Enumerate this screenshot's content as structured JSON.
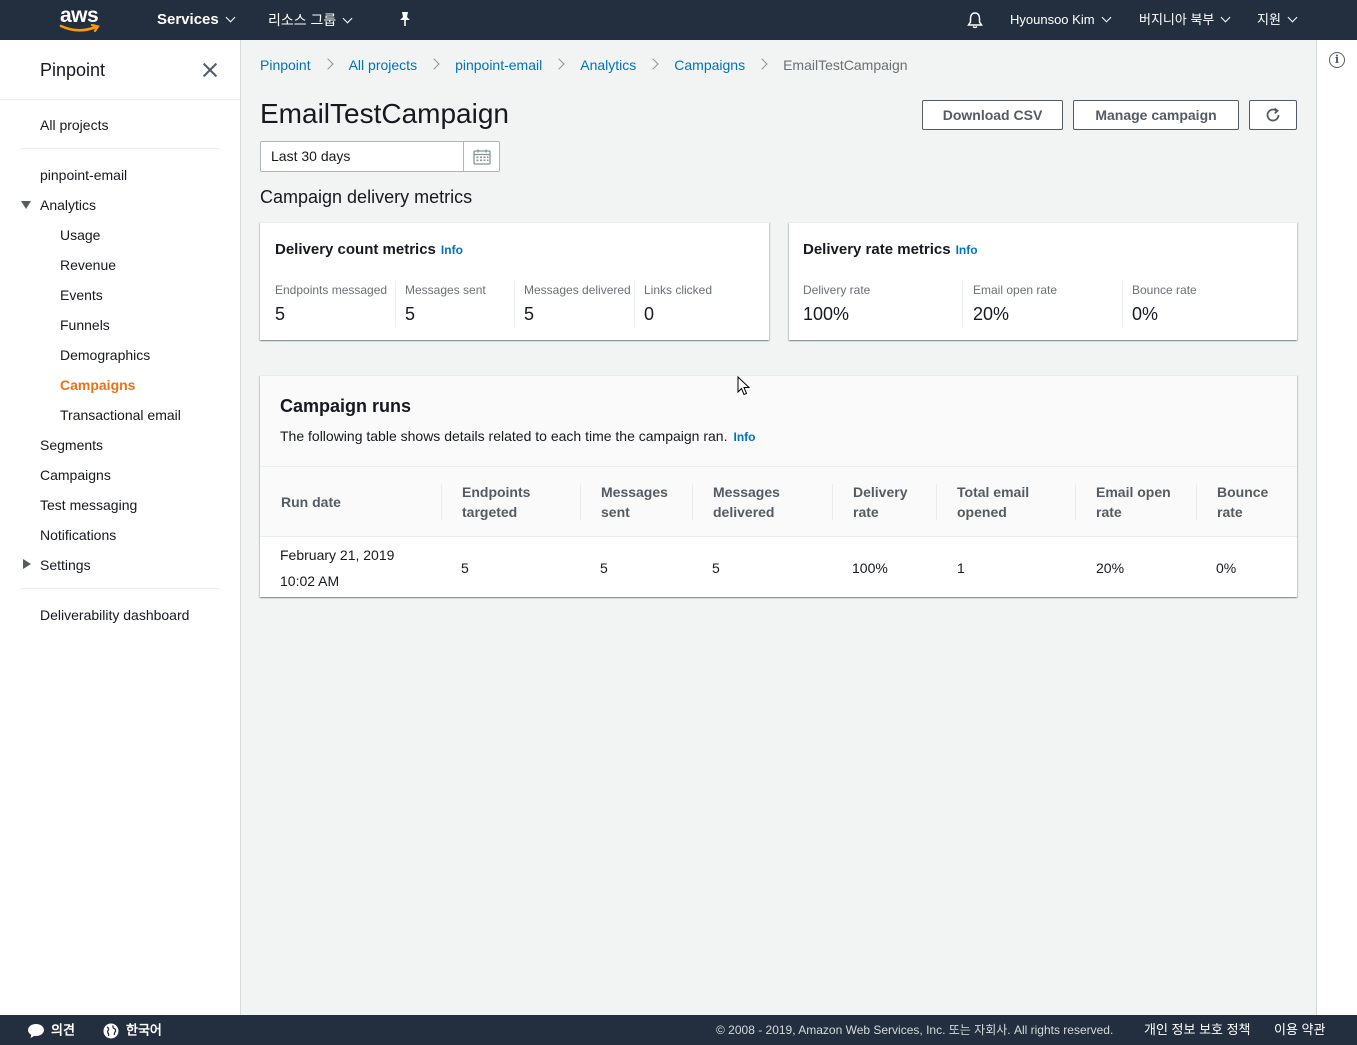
{
  "topnav": {
    "logo_text": "aws",
    "services": "Services",
    "resource_groups": "리소스 그룹",
    "user": "Hyounsoo Kim",
    "region": "버지니아 북부",
    "support": "지원"
  },
  "sidebar": {
    "title": "Pinpoint",
    "all_projects": "All projects",
    "project": "pinpoint-email",
    "analytics": "Analytics",
    "analytics_items": [
      "Usage",
      "Revenue",
      "Events",
      "Funnels",
      "Demographics",
      "Campaigns",
      "Transactional email"
    ],
    "items": [
      "Segments",
      "Campaigns",
      "Test messaging",
      "Notifications"
    ],
    "settings": "Settings",
    "deliverability": "Deliverability dashboard"
  },
  "breadcrumb": [
    "Pinpoint",
    "All projects",
    "pinpoint-email",
    "Analytics",
    "Campaigns",
    "EmailTestCampaign"
  ],
  "page": {
    "title": "EmailTestCampaign",
    "download_csv": "Download CSV",
    "manage_campaign": "Manage campaign",
    "date_range": "Last 30 days",
    "section_heading": "Campaign delivery metrics"
  },
  "count_metrics": {
    "title": "Delivery count metrics",
    "info": "Info",
    "items": [
      {
        "label": "Endpoints messaged",
        "value": "5"
      },
      {
        "label": "Messages sent",
        "value": "5"
      },
      {
        "label": "Messages delivered",
        "value": "5"
      },
      {
        "label": "Links clicked",
        "value": "0"
      }
    ]
  },
  "rate_metrics": {
    "title": "Delivery rate metrics",
    "info": "Info",
    "items": [
      {
        "label": "Delivery rate",
        "value": "100%"
      },
      {
        "label": "Email open rate",
        "value": "20%"
      },
      {
        "label": "Bounce rate",
        "value": "0%"
      }
    ]
  },
  "runs": {
    "title": "Campaign runs",
    "description": "The following table shows details related to each time the campaign ran.",
    "info": "Info",
    "columns": [
      [
        "Run date",
        ""
      ],
      [
        "Endpoints",
        "targeted"
      ],
      [
        "Messages",
        "sent"
      ],
      [
        "Messages",
        "delivered"
      ],
      [
        "Delivery",
        "rate"
      ],
      [
        "Total email",
        "opened"
      ],
      [
        "Email open",
        "rate"
      ],
      [
        "Bounce",
        "rate"
      ]
    ],
    "rows": [
      {
        "date_line1": "February 21, 2019",
        "date_line2": "10:02 AM",
        "cells": [
          "5",
          "5",
          "5",
          "100%",
          "1",
          "20%",
          "0%"
        ]
      }
    ]
  },
  "footer": {
    "feedback": "의견",
    "language": "한국어",
    "copyright": "© 2008 - 2019, Amazon Web Services, Inc. 또는 자회사. All rights reserved.",
    "privacy": "개인 정보 보호 정책",
    "terms": "이용 약관"
  }
}
